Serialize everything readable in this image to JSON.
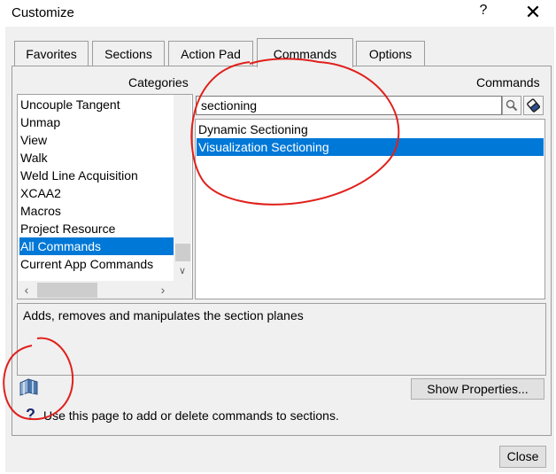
{
  "window": {
    "title": "Customize",
    "help_label": "?",
    "close_label": "✕"
  },
  "tabs": [
    {
      "label": "Favorites",
      "active": false
    },
    {
      "label": "Sections",
      "active": false
    },
    {
      "label": "Action Pad",
      "active": false
    },
    {
      "label": "Commands",
      "active": true
    },
    {
      "label": "Options",
      "active": false
    }
  ],
  "categories": {
    "label": "Categories",
    "items": [
      {
        "label": "Uncouple Tangent",
        "selected": false
      },
      {
        "label": "Unmap",
        "selected": false
      },
      {
        "label": "View",
        "selected": false
      },
      {
        "label": "Walk",
        "selected": false
      },
      {
        "label": "Weld Line Acquisition",
        "selected": false
      },
      {
        "label": "XCAA2",
        "selected": false
      },
      {
        "label": "Macros",
        "selected": false
      },
      {
        "label": "Project Resource",
        "selected": false
      },
      {
        "label": "All Commands",
        "selected": true
      },
      {
        "label": "Current App Commands",
        "selected": false
      }
    ]
  },
  "commands": {
    "label": "Commands",
    "search_value": "sectioning",
    "items": [
      {
        "label": "Dynamic Sectioning",
        "selected": false
      },
      {
        "label": "Visualization Sectioning",
        "selected": true
      }
    ]
  },
  "description": "Adds, removes and manipulates the section planes",
  "buttons": {
    "show_properties": "Show Properties...",
    "close": "Close"
  },
  "hint": "Use this page to add or delete commands to sections.",
  "colors": {
    "selection": "#0078d7",
    "annotation": "#e0201c"
  },
  "icons": [
    "search-icon",
    "eraser-icon",
    "section-plane-icon",
    "help-icon"
  ]
}
